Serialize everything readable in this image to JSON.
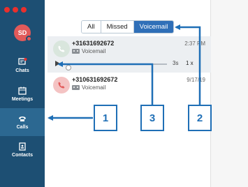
{
  "sidebar": {
    "avatar_initials": "SD",
    "items": [
      {
        "label": "Chats",
        "icon": "chat-icon",
        "active": false
      },
      {
        "label": "Meetings",
        "icon": "calendar-icon",
        "active": false
      },
      {
        "label": "Calls",
        "icon": "phone-icon",
        "active": true
      },
      {
        "label": "Contacts",
        "icon": "contacts-icon",
        "active": false
      }
    ]
  },
  "tabs": [
    {
      "label": "All",
      "selected": false
    },
    {
      "label": "Missed",
      "selected": false
    },
    {
      "label": "Voicemail",
      "selected": true
    }
  ],
  "calls": [
    {
      "number": "+31631692672",
      "time": "2:37 PM",
      "type_label": "Voicemail",
      "player": {
        "duration": "3s",
        "speed": "1 x",
        "progress": 0.05
      }
    },
    {
      "number": "+310631692672",
      "time": "9/17/19",
      "type_label": "Voicemail"
    }
  ],
  "callouts": [
    "1",
    "3",
    "2"
  ],
  "colors": {
    "sidebar_bg": "#1d4f73",
    "accent": "#2f6fb8",
    "callout": "#1f6fb6",
    "missed_red": "#e25a5a"
  }
}
